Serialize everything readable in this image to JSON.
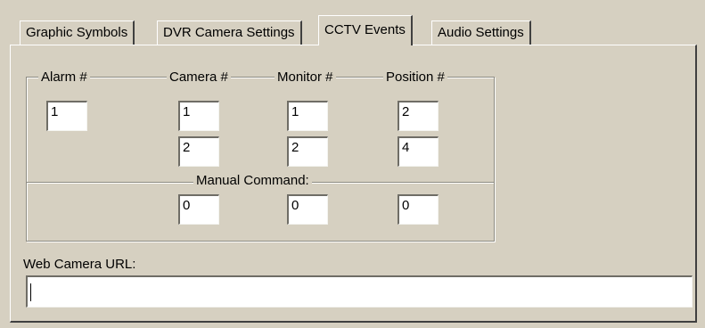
{
  "tabs": [
    {
      "label": "Graphic Symbols"
    },
    {
      "label": "DVR Camera Settings"
    },
    {
      "label": "CCTV Events"
    },
    {
      "label": "Audio Settings"
    }
  ],
  "active_tab": "CCTV Events",
  "columns": {
    "alarm": "Alarm #",
    "camera": "Camera #",
    "monitor": "Monitor #",
    "position": "Position #"
  },
  "fields": {
    "alarm": "1",
    "camera_1": "1",
    "camera_2": "2",
    "monitor_1": "1",
    "monitor_2": "2",
    "position_1": "2",
    "position_2": "4"
  },
  "manual_command": {
    "label": "Manual Command:",
    "camera": "0",
    "monitor": "0",
    "position": "0"
  },
  "web_camera": {
    "label": "Web Camera URL:",
    "value": ""
  }
}
